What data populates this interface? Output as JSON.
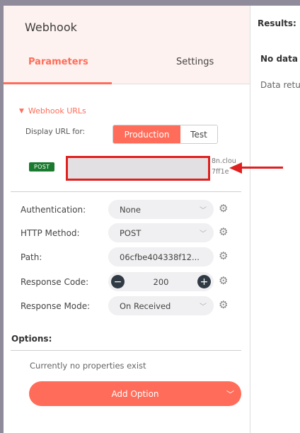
{
  "panel": {
    "title": "Webhook",
    "tabs": {
      "parameters": "Parameters",
      "settings": "Settings"
    }
  },
  "webhook_urls": {
    "section_label": "Webhook URLs",
    "display_label": "Display URL for:",
    "production": "Production",
    "test": "Test",
    "method_badge": "POST",
    "url_tail_line1": "8n.clou",
    "url_tail_line2": "7ff1e"
  },
  "params": {
    "authentication": {
      "label": "Authentication:",
      "value": "None"
    },
    "http_method": {
      "label": "HTTP Method:",
      "value": "POST"
    },
    "path": {
      "label": "Path:",
      "value": "06cfbe404338f12..."
    },
    "response_code": {
      "label": "Response Code:",
      "value": "200"
    },
    "response_mode": {
      "label": "Response Mode:",
      "value": "On Received"
    }
  },
  "options": {
    "label": "Options:",
    "empty_text": "Currently no properties exist",
    "add_button": "Add Option"
  },
  "results": {
    "title": "Results: (",
    "no_data": "No data",
    "subtitle": "Data retu"
  },
  "colors": {
    "accent": "#ff6d5a",
    "post_badge": "#1a7b2e",
    "highlight": "#e02020"
  }
}
